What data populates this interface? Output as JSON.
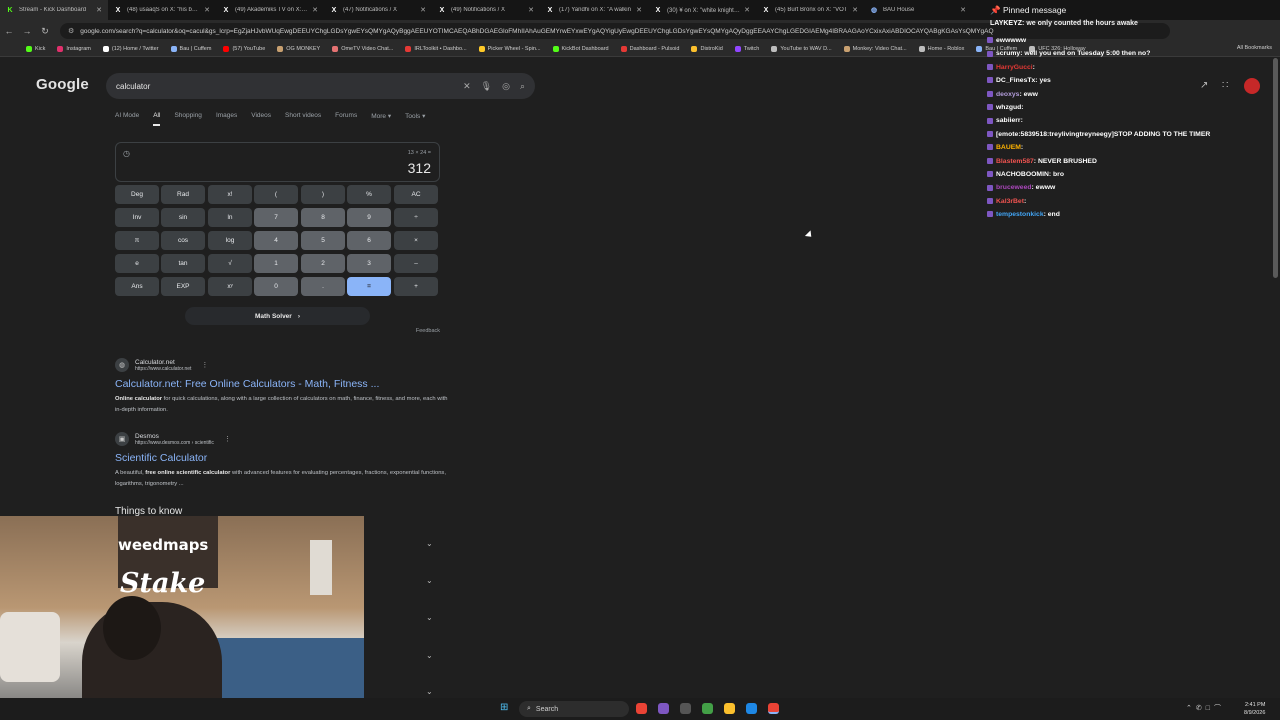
{
  "tabs": [
    {
      "label": "Stream - Kick Dashboard",
      "icon": "kick-icon",
      "color": "#53fc18"
    },
    {
      "label": "(48) usaaqS on X: \"his burn",
      "icon": "x-icon",
      "color": "#ffffff"
    },
    {
      "label": "(49) Akademiks TV on X: \"A",
      "icon": "x-icon",
      "color": "#ffffff"
    },
    {
      "label": "(47) Notifications / X",
      "icon": "x-icon",
      "color": "#ffffff"
    },
    {
      "label": "(49) Notifications / X",
      "icon": "x-icon",
      "color": "#ffffff"
    },
    {
      "label": "(17) Yandhi on X: \"A walkin",
      "icon": "x-icon",
      "color": "#ffffff"
    },
    {
      "label": "(30) ¥ on X: \"white knight \u0001",
      "icon": "x-icon",
      "color": "#ffffff"
    },
    {
      "label": "(45) Burt Bronx on X: \"VOT",
      "icon": "x-icon",
      "color": "#ffffff"
    },
    {
      "label": "BAU House",
      "icon": "globe-icon",
      "color": "#8ab4f8"
    }
  ],
  "address": {
    "url": "google.com/search?q=calculator&oq=cacul&gs_lcrp=EgZjaHJvbWUqEwgDEEUYChgLGDsYgwEYsQMYgAQyBggAEEUYOTIMCAEQABhDGAEGloFMhIIAhAuGEMYrwEYxwEYgAQYigUyEwgDEEUYChgLGDsYgwEYsQMYgAQyDggEEAAYChgLGEDGIAEMg4IBRAAGAoYCxixAxiABDIOCAYQABgKGAsYsQMYgAQ"
  },
  "bookmarks": [
    {
      "label": "Kick",
      "color": "#53fc18"
    },
    {
      "label": "Instagram",
      "color": "#e1306c"
    },
    {
      "label": "(12) Home / Twitter",
      "color": "#ffffff"
    },
    {
      "label": "Bau | Cuffem",
      "color": "#8ab4f8"
    },
    {
      "label": "(57) YouTube",
      "color": "#ff0000"
    },
    {
      "label": "OG MONKEY",
      "color": "#c8a070"
    },
    {
      "label": "OmeTV Video Chat...",
      "color": "#e57373"
    },
    {
      "label": "IRLToolkit • Dashbo...",
      "color": "#e53935"
    },
    {
      "label": "Picker Wheel - Spin...",
      "color": "#ffca28"
    },
    {
      "label": "KickBot Dashboard",
      "color": "#53fc18"
    },
    {
      "label": "Dashboard - Pulsoid",
      "color": "#e53935"
    },
    {
      "label": "DistroKid",
      "color": "#fbc02d"
    },
    {
      "label": "Twitch",
      "color": "#9146ff"
    },
    {
      "label": "YouTube to WAV D...",
      "color": "#bdbdbd"
    },
    {
      "label": "Monkey: Video Chat...",
      "color": "#c8a070"
    },
    {
      "label": "Home - Roblox",
      "color": "#bdbdbd"
    },
    {
      "label": "Bau | Cuffem",
      "color": "#8ab4f8"
    },
    {
      "label": "UFC 326: Holloway",
      "color": "#bdbdbd"
    }
  ],
  "bookmarks_all": "All Bookmarks",
  "google": {
    "logo": "Google",
    "query": "calculator",
    "tabs": [
      "AI Mode",
      "All",
      "Shopping",
      "Images",
      "Videos",
      "Short videos",
      "Forums",
      "More ▾",
      "Tools ▾"
    ],
    "active_tab": 1
  },
  "calculator": {
    "expression": "13 × 24 =",
    "result": "312",
    "keys": [
      [
        "Deg",
        "Rad",
        "x!",
        "(",
        ")",
        "%",
        "AC"
      ],
      [
        "Inv",
        "sin",
        "ln",
        "7",
        "8",
        "9",
        "÷"
      ],
      [
        "π",
        "cos",
        "log",
        "4",
        "5",
        "6",
        "×"
      ],
      [
        "e",
        "tan",
        "√",
        "1",
        "2",
        "3",
        "–"
      ],
      [
        "Ans",
        "EXP",
        "xʸ",
        "0",
        ".",
        "=",
        "+"
      ]
    ],
    "math_solver": "Math Solver",
    "feedback": "Feedback"
  },
  "results": [
    {
      "site": "Calculator.net",
      "url": "https://www.calculator.net",
      "title": "Calculator.net: Free Online Calculators - Math, Fitness ...",
      "snippet_bold": "Online calculator",
      "snippet": " for quick calculations, along with a large collection of calculators on math, finance, fitness, and more, each with in-depth information."
    },
    {
      "site": "Desmos",
      "url": "https://www.desmos.com › scientific",
      "title": "Scientific Calculator",
      "snippet_pre": "A beautiful, ",
      "snippet_bold": "free online scientific calculator",
      "snippet": " with advanced features for evaluating percentages, fractions, exponential functions, logarithms, trigonometry ..."
    }
  ],
  "things_to_know": "Things to know",
  "chat": {
    "pinned_title": "Pinned message",
    "pinned_user": "LAYKEYZ",
    "pinned_text": "we only counted the hours awake",
    "messages": [
      {
        "user": "",
        "text": "ewwwww",
        "color": "#e53935"
      },
      {
        "user": "scrumy",
        "text": "well you end on Tuesday 5:00 then no?",
        "color": "#ffffff"
      },
      {
        "user": "HarryGucci",
        "text": "",
        "color": "#e53935"
      },
      {
        "user": "DC_FinesTx",
        "text": "yes",
        "color": "#ffffff"
      },
      {
        "user": "deoxys",
        "text": "eww",
        "color": "#b39ddb"
      },
      {
        "user": "whzgud",
        "text": "",
        "color": "#ffffff"
      },
      {
        "user": "sabiierr",
        "text": "",
        "color": "#ffffff"
      },
      {
        "user": "",
        "text": "[emote:5839518:treylivingtreyneegy]STOP ADDING TO THE TIMER",
        "color": "#e53935"
      },
      {
        "user": "BAUEM",
        "text": "",
        "color": "#ffb300"
      },
      {
        "user": "Blastem587",
        "text": "NEVER BRUSHED",
        "color": "#ef5350"
      },
      {
        "user": "NACHOBOOMIN",
        "text": "bro",
        "color": "#ffffff"
      },
      {
        "user": "bruceweed",
        "text": "ewww",
        "color": "#ab47bc"
      },
      {
        "user": "Kal3rBet",
        "text": "",
        "color": "#ef5350"
      },
      {
        "user": "tempestonkick",
        "text": "end",
        "color": "#42a5f5"
      }
    ]
  },
  "webcam": {
    "sign_top": "weedmaps",
    "sign_bottom": "Stake"
  },
  "taskbar": {
    "search_label": "Search",
    "time": "2:41 PM",
    "date": "8/9/2026"
  }
}
